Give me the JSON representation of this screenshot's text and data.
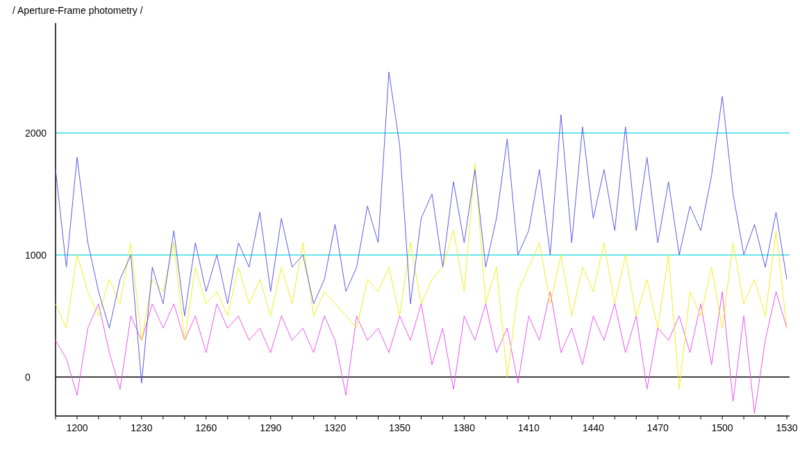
{
  "chart_data": {
    "type": "line",
    "title": "/ Aperture-Frame photometry /",
    "x": [
      1190,
      1195,
      1200,
      1205,
      1210,
      1215,
      1220,
      1225,
      1230,
      1235,
      1240,
      1245,
      1250,
      1255,
      1260,
      1265,
      1270,
      1275,
      1280,
      1285,
      1290,
      1295,
      1300,
      1305,
      1310,
      1315,
      1320,
      1325,
      1330,
      1335,
      1340,
      1345,
      1350,
      1355,
      1360,
      1365,
      1370,
      1375,
      1380,
      1385,
      1390,
      1395,
      1400,
      1405,
      1410,
      1415,
      1420,
      1425,
      1430,
      1435,
      1440,
      1445,
      1450,
      1455,
      1460,
      1465,
      1470,
      1475,
      1480,
      1485,
      1490,
      1495,
      1500,
      1505,
      1510,
      1515,
      1520,
      1525,
      1530
    ],
    "series": [
      {
        "color": "#5a5ae8",
        "values": [
          1700,
          900,
          1800,
          1100,
          700,
          400,
          800,
          1000,
          -50,
          900,
          600,
          1200,
          500,
          1100,
          700,
          1000,
          600,
          1100,
          900,
          1350,
          700,
          1300,
          900,
          1000,
          600,
          800,
          1250,
          700,
          900,
          1400,
          1100,
          2500,
          1900,
          600,
          1300,
          1500,
          900,
          1600,
          1100,
          1700,
          900,
          1300,
          1950,
          1000,
          1200,
          1700,
          1000,
          2150,
          1100,
          2050,
          1300,
          1700,
          1200,
          2050,
          1200,
          1800,
          1100,
          1600,
          1000,
          1400,
          1200,
          1650,
          2300,
          1500,
          1000,
          1250,
          900,
          1350,
          800
        ]
      },
      {
        "color": "#f0f020",
        "values": [
          600,
          400,
          1000,
          700,
          500,
          800,
          600,
          1100,
          300,
          800,
          700,
          1100,
          300,
          900,
          600,
          700,
          500,
          900,
          600,
          800,
          500,
          900,
          600,
          1100,
          500,
          700,
          600,
          500,
          400,
          800,
          700,
          900,
          500,
          1100,
          600,
          800,
          900,
          1200,
          700,
          1750,
          600,
          900,
          0,
          700,
          900,
          1100,
          600,
          1000,
          500,
          900,
          700,
          1100,
          600,
          1000,
          500,
          800,
          400,
          1000,
          -100,
          700,
          500,
          900,
          400,
          1100,
          600,
          800,
          500,
          1200,
          400
        ]
      },
      {
        "color": "#ee55ee",
        "values": [
          300,
          150,
          -150,
          400,
          600,
          200,
          -100,
          500,
          300,
          600,
          400,
          600,
          300,
          500,
          200,
          600,
          400,
          500,
          300,
          400,
          200,
          500,
          300,
          400,
          200,
          500,
          300,
          -150,
          500,
          300,
          400,
          200,
          500,
          300,
          600,
          100,
          400,
          -100,
          500,
          300,
          600,
          200,
          400,
          -50,
          500,
          300,
          700,
          200,
          400,
          100,
          500,
          300,
          600,
          200,
          500,
          -100,
          400,
          300,
          500,
          200,
          600,
          100,
          700,
          -200,
          500,
          -300,
          300,
          700,
          400
        ]
      }
    ],
    "xlim": [
      1190,
      1530
    ],
    "ylim": [
      -320,
      2900
    ],
    "xticks": [
      1200,
      1230,
      1260,
      1290,
      1320,
      1350,
      1380,
      1410,
      1440,
      1470,
      1500,
      1530
    ],
    "yticks": [
      2000,
      1000,
      0
    ]
  }
}
